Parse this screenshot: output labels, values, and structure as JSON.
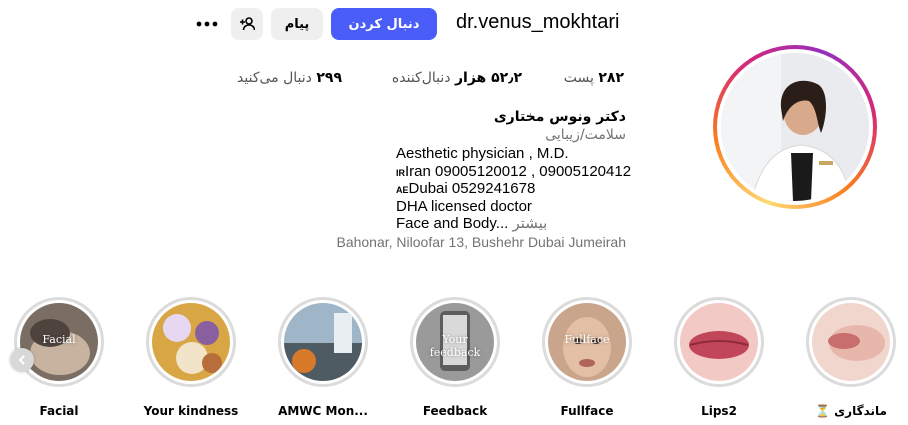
{
  "profile": {
    "username": "dr.venus_mokhtari",
    "follow_label": "دنبال کردن",
    "message_label": "پیام",
    "stats": {
      "posts_count": "۲۸۲",
      "posts_label": "پست",
      "followers_count": "۵۲٫۲ هزار",
      "followers_label": "دنبال‌کننده",
      "following_count": "۲۹۹",
      "following_label": "دنبال می‌کنید"
    },
    "bio": {
      "name": "دکتر ونوس مختاری",
      "category": "سلامت/زیبایی",
      "line1": "Aesthetic physician , M.D.",
      "line2_flag": "IR",
      "line2": "Iran 09005120012 , 09005120412",
      "line3_flag": "AE",
      "line3": "Dubai 0529241678",
      "line4": "DHA licensed doctor",
      "line5": "Face and Body...",
      "more_label": "بیشتر",
      "address": "Bahonar, Niloofar 13, Bushehr Dubai Jumeirah"
    }
  },
  "highlights": [
    {
      "label": "Facial",
      "overlay": "Facial",
      "icon": "highlight-facial"
    },
    {
      "label": "Your kindness",
      "overlay": "",
      "icon": "highlight-flowers"
    },
    {
      "label": "AMWC Mon...",
      "overlay": "",
      "icon": "highlight-event"
    },
    {
      "label": "Feedback",
      "overlay": "Your feedback",
      "icon": "highlight-phone"
    },
    {
      "label": "Fullface",
      "overlay": "Fullface",
      "icon": "highlight-face"
    },
    {
      "label": "Lips2",
      "overlay": "",
      "icon": "highlight-lips"
    },
    {
      "label": "⏳ ماندگاری",
      "overlay": "",
      "icon": "highlight-lips-closeup"
    }
  ],
  "colors": {
    "accent": "#4a5df9",
    "secondary_button": "#efefef",
    "muted_text": "#737373"
  }
}
